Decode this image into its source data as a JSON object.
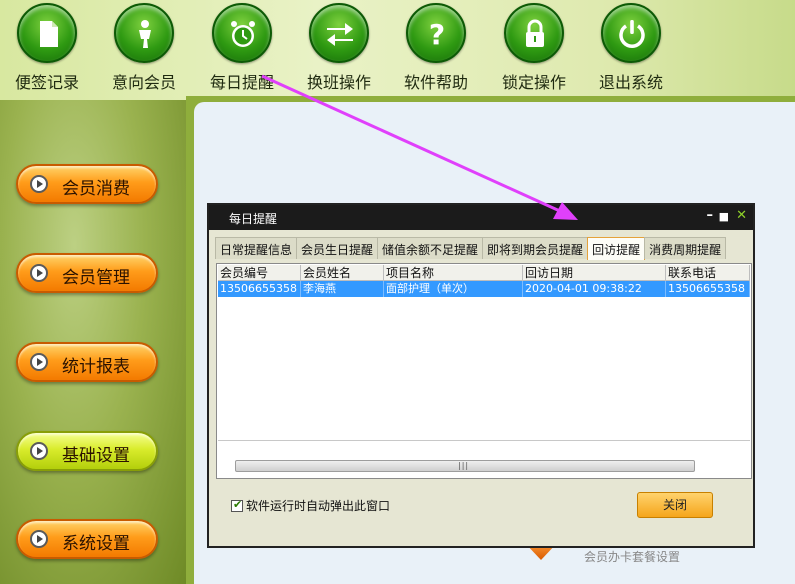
{
  "toolbar": {
    "items": [
      {
        "label": "便签记录",
        "icon": "note-icon"
      },
      {
        "label": "意向会员",
        "icon": "person-icon"
      },
      {
        "label": "每日提醒",
        "icon": "alarm-clock-icon"
      },
      {
        "label": "换班操作",
        "icon": "swap-arrows-icon"
      },
      {
        "label": "软件帮助",
        "icon": "help-icon"
      },
      {
        "label": "锁定操作",
        "icon": "lock-icon"
      },
      {
        "label": "退出系统",
        "icon": "power-icon"
      }
    ]
  },
  "sidebar": {
    "items": [
      {
        "label": "会员消费"
      },
      {
        "label": "会员管理"
      },
      {
        "label": "统计报表"
      },
      {
        "label": "基础设置"
      },
      {
        "label": "系统设置"
      }
    ]
  },
  "background": {
    "caption": "会员办卡套餐设置"
  },
  "dialog": {
    "title": "每日提醒",
    "tabs": [
      "日常提醒信息",
      "会员生日提醒",
      "储值余额不足提醒",
      "即将到期会员提醒",
      "回访提醒",
      "消费周期提醒"
    ],
    "active_tab": "回访提醒",
    "table": {
      "columns": [
        "会员编号",
        "会员姓名",
        "项目名称",
        "回访日期",
        "联系电话"
      ],
      "rows": [
        [
          "13506655358",
          "李海燕",
          "面部护理（单次）",
          "2020-04-01 09:38:22",
          "13506655358"
        ]
      ]
    },
    "scroll_grip": "|||",
    "auto_popup_label": "软件运行时自动弹出此窗口",
    "auto_popup_checked": true,
    "close_label": "关闭"
  },
  "colors": {
    "accent_orange": "#f37a00",
    "selection_blue": "#3399ff",
    "annotation_arrow": "#e040fb"
  }
}
